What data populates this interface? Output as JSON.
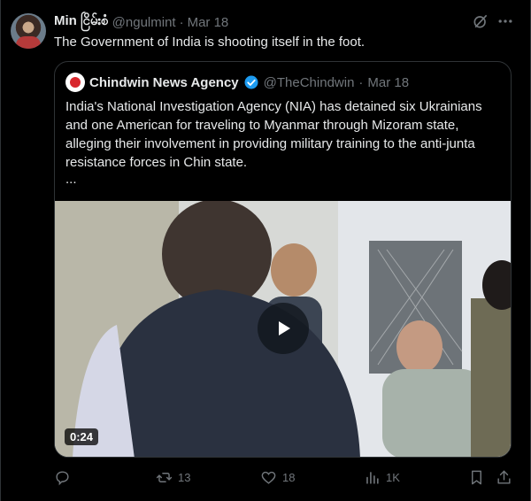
{
  "tweet": {
    "author_name": "Min ငြိမ်းစံ",
    "author_handle": "@ngulmint",
    "dot": "·",
    "date": "Mar 18",
    "text": "The Government of India is shooting itself in the foot."
  },
  "quote": {
    "author_name": "Chindwin News Agency",
    "author_handle": "@TheChindwin",
    "dot": "·",
    "date": "Mar 18",
    "text": "India's National Investigation Agency (NIA) has detained six Ukrainians and one American for traveling to Myanmar through Mizoram state, alleging their involvement in providing military training to the anti-junta resistance forces in Chin state.",
    "ellipsis": "...",
    "video_duration": "0:24"
  },
  "actions": {
    "replies": "",
    "reposts": "13",
    "likes": "18",
    "views": "1K"
  },
  "colors": {
    "background": "#000000",
    "text": "#e7e9ea",
    "muted": "#71767b",
    "border": "#2f3336",
    "verified": "#1d9bf0"
  }
}
